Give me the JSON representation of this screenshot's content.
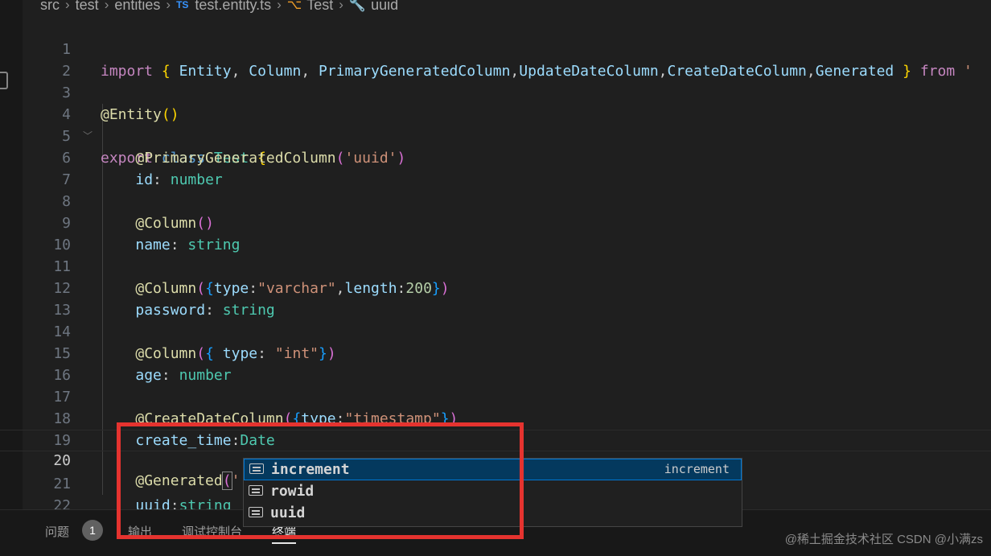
{
  "breadcrumb": {
    "items": [
      "src",
      "test",
      "entities",
      "test.entity.ts",
      "Test",
      "uuid"
    ],
    "ts_badge": "TS"
  },
  "editor": {
    "lines": [
      {
        "n": "1"
      },
      {
        "n": "2"
      },
      {
        "n": "3"
      },
      {
        "n": "4"
      },
      {
        "n": "5"
      },
      {
        "n": "6"
      },
      {
        "n": "7"
      },
      {
        "n": "8"
      },
      {
        "n": "9"
      },
      {
        "n": "10"
      },
      {
        "n": "11"
      },
      {
        "n": "12"
      },
      {
        "n": "13"
      },
      {
        "n": "14"
      },
      {
        "n": "15"
      },
      {
        "n": "16"
      },
      {
        "n": "17"
      },
      {
        "n": "18"
      },
      {
        "n": "19"
      },
      {
        "n": "20"
      },
      {
        "n": "21"
      },
      {
        "n": "22"
      }
    ],
    "tok": {
      "import": "import",
      "entity": "Entity",
      "column": "Column",
      "pgc": "PrimaryGeneratedColumn",
      "udc": "UpdateDateColumn",
      "cdc": "CreateDateColumn",
      "generated": "Generated",
      "from": "from",
      "quote": "'",
      "export": "export",
      "class": "class",
      "test": "Test",
      "uuid_str": "'uuid'",
      "id": "id",
      "number": "number",
      "name": "name",
      "string": "string",
      "type": "type",
      "varchar": "\"varchar\"",
      "length": "length",
      "n200": "200",
      "password": "password",
      "int": "\"int\"",
      "age": "age",
      "timestamp": "\"timestamp\"",
      "create_time": "create_time",
      "date": "Date",
      "empty_str": "''",
      "uuid": "uuid"
    }
  },
  "suggest": {
    "items": [
      {
        "label": "increment",
        "detail": "increment",
        "selected": true
      },
      {
        "label": "rowid"
      },
      {
        "label": "uuid"
      }
    ]
  },
  "panel": {
    "tabs": [
      "问题",
      "输出",
      "调试控制台",
      "终端"
    ],
    "problems_count": "1",
    "active_tab": "终端"
  },
  "watermark": "@稀土掘金技术社区",
  "watermark2": "CSDN @小满zs"
}
